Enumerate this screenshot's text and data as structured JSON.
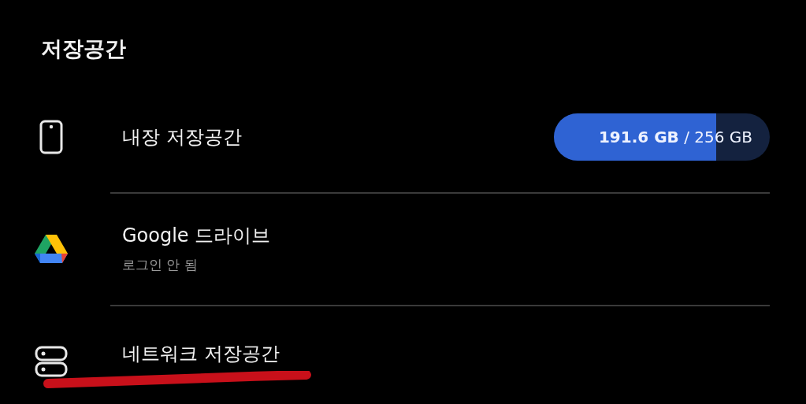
{
  "header": {
    "title": "저장공간"
  },
  "items": [
    {
      "kind": "phone",
      "title": "내장 저장공간",
      "usage": {
        "text": "**191.6 GB** / 256 GB",
        "level": 0.75
      }
    },
    {
      "kind": "drive",
      "title": "Google 드라이브",
      "subtitle": "로그인 안 됨"
    },
    {
      "kind": "network",
      "title": "네트워크 저장공간"
    }
  ]
}
